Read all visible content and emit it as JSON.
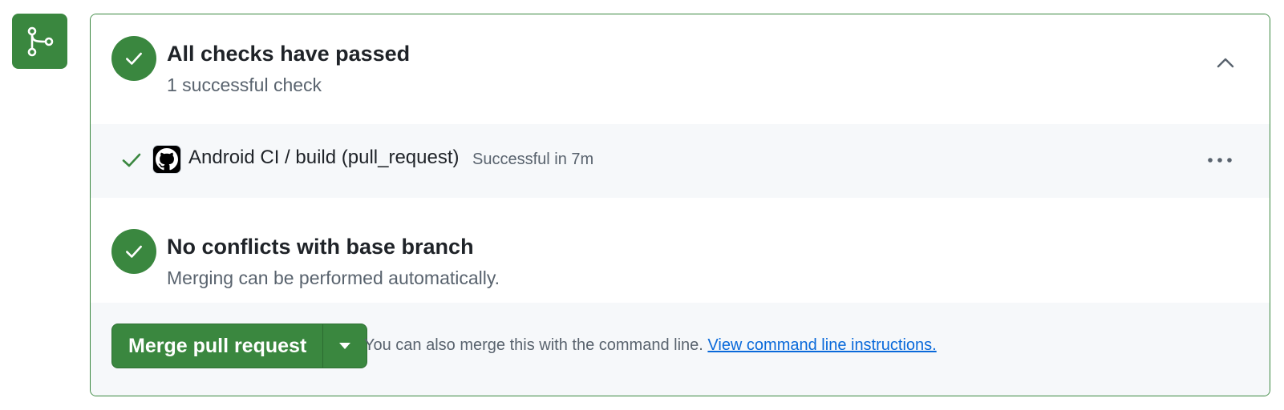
{
  "checks": {
    "title": "All checks have passed",
    "subtitle": "1 successful check",
    "collapse_icon": "chevron-up-icon",
    "items": [
      {
        "name": "Android CI / build (pull_request)",
        "status": "Successful in 7m",
        "status_icon": "check-icon",
        "avatar_icon": "github-icon"
      }
    ],
    "more_icon": "kebab-horizontal-icon"
  },
  "conflicts": {
    "title": "No conflicts with base branch",
    "subtitle": "Merging can be performed automatically."
  },
  "merge": {
    "button_label": "Merge pull request",
    "dropdown_icon": "triangle-down-icon",
    "hint_text": "You can also merge this with the command line.",
    "hint_link": "View command line instructions."
  },
  "colors": {
    "success": "#3a873f",
    "link": "#0969da",
    "muted": "#59636e",
    "row_background": "#f6f8fa"
  }
}
